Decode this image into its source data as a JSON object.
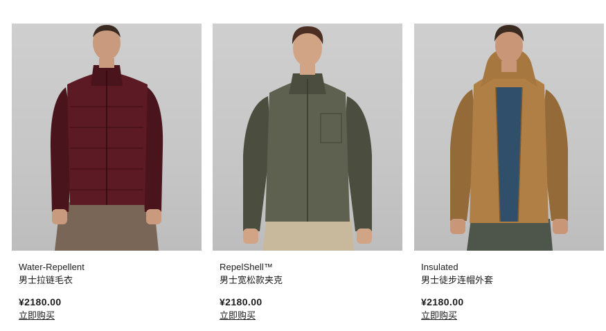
{
  "products": [
    {
      "name_en": "Water-Repellent",
      "name_cn": "男士拉链毛衣",
      "price": "¥2180.00",
      "cta": "立即购买",
      "image_icon": "product-photo-burgundy-zip-sweater",
      "colors": {
        "garment": "#5b1a24",
        "garment_dark": "#4a141c",
        "pants": "#7a6656",
        "skin": "#c99a7e",
        "hair": "#3a2a22"
      }
    },
    {
      "name_en": "RepelShell™",
      "name_cn": "男士宽松款夹克",
      "price": "¥2180.00",
      "cta": "立即购买",
      "image_icon": "product-photo-olive-shell-jacket",
      "colors": {
        "garment": "#5e614f",
        "garment_dark": "#4b4e3f",
        "pants": "#c9b99c",
        "skin": "#d2a486",
        "hair": "#4a2f22"
      }
    },
    {
      "name_en": "Insulated",
      "name_cn": "男士徒步连帽外套",
      "price": "¥2180.00",
      "cta": "立即购买",
      "image_icon": "product-photo-tan-hooded-jacket",
      "colors": {
        "garment": "#b07f45",
        "garment_dark": "#946a38",
        "inner": "#2f4f6b",
        "pants": "#4e564c",
        "skin": "#c99677",
        "hair": "#3b2a20"
      }
    }
  ]
}
